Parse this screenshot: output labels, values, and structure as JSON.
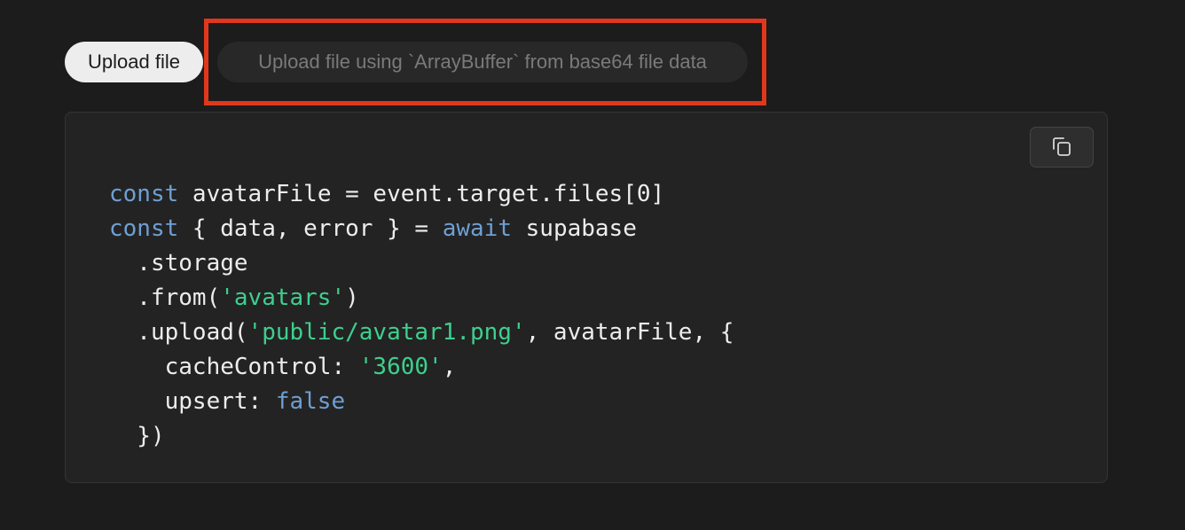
{
  "tabs": [
    {
      "label": "Upload file",
      "active": true
    },
    {
      "label": "Upload file using `ArrayBuffer` from base64 file data",
      "active": false
    }
  ],
  "copy_button": {
    "icon": "copy-icon"
  },
  "code": {
    "language": "javascript",
    "lines": [
      {
        "tokens": [
          {
            "type": "kw",
            "text": "const"
          },
          {
            "type": "plain",
            "text": " avatarFile = event.target.files[0]"
          }
        ]
      },
      {
        "tokens": [
          {
            "type": "kw",
            "text": "const"
          },
          {
            "type": "plain",
            "text": " { data, error } = "
          },
          {
            "type": "kw",
            "text": "await"
          },
          {
            "type": "plain",
            "text": " supabase"
          }
        ]
      },
      {
        "tokens": [
          {
            "type": "plain",
            "text": "  .storage"
          }
        ]
      },
      {
        "tokens": [
          {
            "type": "plain",
            "text": "  .from("
          },
          {
            "type": "str",
            "text": "'avatars'"
          },
          {
            "type": "plain",
            "text": ")"
          }
        ]
      },
      {
        "tokens": [
          {
            "type": "plain",
            "text": "  .upload("
          },
          {
            "type": "str",
            "text": "'public/avatar1.png'"
          },
          {
            "type": "plain",
            "text": ", avatarFile, {"
          }
        ]
      },
      {
        "tokens": [
          {
            "type": "plain",
            "text": "    cacheControl: "
          },
          {
            "type": "str",
            "text": "'3600'"
          },
          {
            "type": "plain",
            "text": ","
          }
        ]
      },
      {
        "tokens": [
          {
            "type": "plain",
            "text": "    upsert: "
          },
          {
            "type": "kw",
            "text": "false"
          }
        ]
      },
      {
        "tokens": [
          {
            "type": "plain",
            "text": "  })"
          }
        ]
      }
    ]
  },
  "colors": {
    "background": "#1c1c1c",
    "keyword": "#6f9fd3",
    "string": "#3ecf8e",
    "highlight": "#e0381c"
  }
}
